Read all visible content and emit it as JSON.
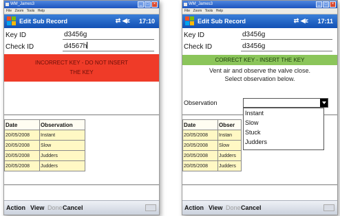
{
  "colors": {
    "header_blue": "#1e5fc6",
    "error_red": "#ef3b28",
    "success_green": "#8bc55a",
    "grid_row": "#fff8c4"
  },
  "emulator": {
    "title": "WM_James3",
    "menu": [
      "File",
      "Zoom",
      "Tools",
      "Help"
    ]
  },
  "left": {
    "app_title": "Edit Sub Record",
    "status_icons": "⇄ ◀ε",
    "time": "17:10",
    "key_id_label": "Key ID",
    "key_id_value": "d3456g",
    "check_id_label": "Check ID",
    "check_id_value": "d4567h",
    "banner_line1": "INCORRECT KEY - DO NOT INSERT",
    "banner_line2": "THE KEY",
    "grid": {
      "headers": [
        "Date",
        "Observation"
      ],
      "rows": [
        [
          "20/05/2008",
          "Instant"
        ],
        [
          "20/05/2008",
          "Slow"
        ],
        [
          "20/05/2008",
          "Judders"
        ],
        [
          "20/05/2008",
          "Judders"
        ]
      ]
    },
    "bottom": {
      "action": "Action",
      "view": "View",
      "done": "Done",
      "cancel": "Cancel"
    }
  },
  "right": {
    "app_title": "Edit Sub Record",
    "status_icons": "⇄ ◀ε",
    "time": "17:11",
    "key_id_label": "Key ID",
    "key_id_value": "d3456g",
    "check_id_label": "Check ID",
    "check_id_value": "d3456g",
    "banner": "CORRECT KEY - INSERT THE KEY",
    "instruction_line1": "Vent air and observe the valve close.",
    "instruction_line2": "Select observation below.",
    "observation_label": "Observation",
    "observation_selected": "",
    "observation_options": [
      "Instant",
      "Slow",
      "Stuck",
      "Judders"
    ],
    "grid": {
      "headers": [
        "Date",
        "Obser"
      ],
      "rows": [
        [
          "20/05/2008",
          "Instan"
        ],
        [
          "20/05/2008",
          "Slow"
        ],
        [
          "20/05/2008",
          "Judders"
        ],
        [
          "20/05/2008",
          "Judders"
        ]
      ]
    },
    "bottom": {
      "action": "Action",
      "view": "View",
      "done": "Done",
      "cancel": "Cancel"
    }
  }
}
